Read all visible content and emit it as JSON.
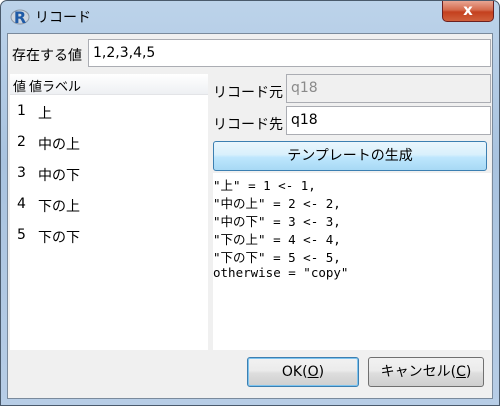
{
  "window": {
    "title": "リコード",
    "app_icon_letter": "R",
    "close_glyph": "x"
  },
  "existing_values": {
    "label": "存在する値",
    "value": "1,2,3,4,5"
  },
  "value_table": {
    "headers": [
      "値",
      "値ラベル"
    ],
    "rows": [
      {
        "value": "1",
        "label": "上"
      },
      {
        "value": "2",
        "label": "中の上"
      },
      {
        "value": "3",
        "label": "中の下"
      },
      {
        "value": "4",
        "label": "下の上"
      },
      {
        "value": "5",
        "label": "下の下"
      }
    ]
  },
  "recode_source": {
    "label": "リコード元",
    "value": "q18"
  },
  "recode_target": {
    "label": "リコード先",
    "value": "q18"
  },
  "template_button": {
    "label": "テンプレートの生成"
  },
  "code_lines": [
    "\"上\" = 1 <- 1,",
    "\"中の上\" = 2 <- 2,",
    "\"中の下\" = 3 <- 3,",
    "\"下の上\" = 4 <- 4,",
    "\"下の下\" = 5 <- 5,",
    "otherwise = \"copy\""
  ],
  "buttons": {
    "ok": {
      "label_before": "OK(",
      "mnemonic": "O",
      "label_after": ")"
    },
    "cancel": {
      "label_before": "キャンセル(",
      "mnemonic": "C",
      "label_after": ")"
    }
  },
  "colors": {
    "accent": "#3c7fb1",
    "close": "#c4401e",
    "r_icon": "#1f5aa6"
  }
}
